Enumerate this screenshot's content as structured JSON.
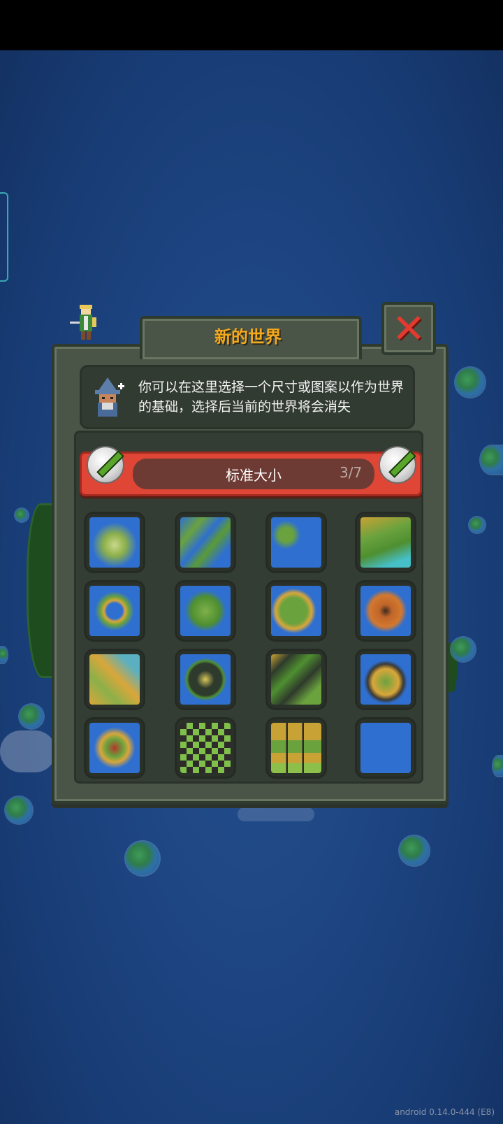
{
  "dialog": {
    "title": "新的世界",
    "info_text": "你可以在这里选择一个尺寸或图案以作为世界的基础，选择后当前的世界将会消失",
    "close_icon": "close-icon"
  },
  "size_selector": {
    "label": "标准大小",
    "count": "3/7"
  },
  "templates": [
    {
      "name": "map-template-1"
    },
    {
      "name": "map-template-2"
    },
    {
      "name": "map-template-3"
    },
    {
      "name": "map-template-4"
    },
    {
      "name": "map-template-5"
    },
    {
      "name": "map-template-6"
    },
    {
      "name": "map-template-7"
    },
    {
      "name": "map-template-8"
    },
    {
      "name": "map-template-9"
    },
    {
      "name": "map-template-10"
    },
    {
      "name": "map-template-11"
    },
    {
      "name": "map-template-12"
    },
    {
      "name": "map-template-13"
    },
    {
      "name": "map-template-14"
    },
    {
      "name": "map-template-15"
    },
    {
      "name": "map-template-16-empty"
    }
  ],
  "footer": {
    "version": "android 0.14.0-444 (E8)"
  },
  "colors": {
    "title": "#f5a91c",
    "close": "#e23a2f",
    "selector_red": "#e04636",
    "water": "#2f6fd0"
  }
}
